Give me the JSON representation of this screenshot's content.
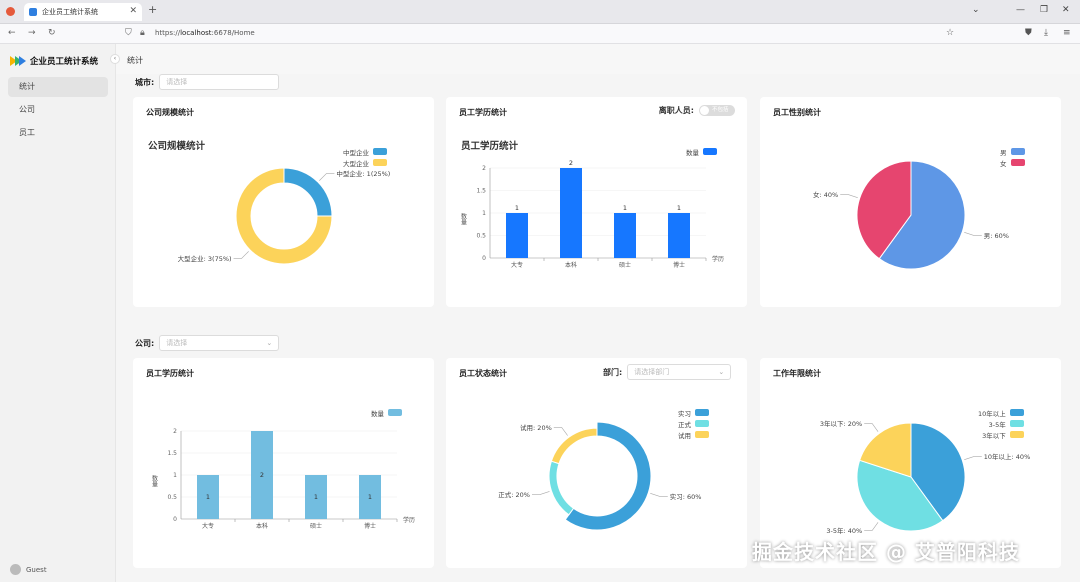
{
  "browser": {
    "tab_title": "企业员工统计系统",
    "url_prefix": "https://",
    "url_host": "localhost",
    "url_rest": ":6678/Home"
  },
  "sidebar": {
    "app_title": "企业员工统计系统",
    "items": [
      {
        "label": "统计",
        "active": true
      },
      {
        "label": "公司",
        "active": false
      },
      {
        "label": "员工",
        "active": false
      }
    ],
    "user": "Guest"
  },
  "breadcrumb": "统计",
  "filters": {
    "city_label": "城市:",
    "city_placeholder": "请选择",
    "company_label": "公司:",
    "company_placeholder": "请选择"
  },
  "cards": {
    "company_scale": {
      "title": "公司规模统计",
      "chart_title": "公司规模统计"
    },
    "edu1": {
      "title": "员工学历统计",
      "chart_title": "员工学历统计",
      "toggle_label": "离职人员:",
      "toggle_text": "不包括"
    },
    "gender": {
      "title": "员工性别统计"
    },
    "edu2": {
      "title": "员工学历统计"
    },
    "status": {
      "title": "员工状态统计",
      "dept_label": "部门:",
      "dept_placeholder": "请选择部门"
    },
    "tenure": {
      "title": "工作年限统计"
    }
  },
  "colors": {
    "blue": "#3ba0d9",
    "yellow": "#fcd35a",
    "bar_blue": "#1677ff",
    "male": "#5e97e6",
    "female": "#e6456f",
    "light_bar": "#72bde0",
    "cyan": "#6fdfe3"
  },
  "chart_data": [
    {
      "type": "pie",
      "subtype": "donut",
      "legend": [
        "中型企业",
        "大型企业"
      ],
      "slices": [
        {
          "name": "中型企业",
          "value": 1,
          "label": "中型企业: 1(25%)"
        },
        {
          "name": "大型企业",
          "value": 3,
          "label": "大型企业: 3(75%)"
        }
      ]
    },
    {
      "type": "bar",
      "categories": [
        "大专",
        "本科",
        "硕士",
        "博士"
      ],
      "series": [
        {
          "name": "数量",
          "values": [
            1,
            2,
            1,
            1
          ]
        }
      ],
      "ylabel": "数量",
      "xlabel": "学历",
      "yticks": [
        "0",
        "0.5",
        "1",
        "1.5",
        "2"
      ],
      "ylim": [
        0,
        2
      ]
    },
    {
      "type": "pie",
      "legend": [
        "男",
        "女"
      ],
      "slices": [
        {
          "name": "男",
          "value": 60,
          "label": "男: 60%"
        },
        {
          "name": "女",
          "value": 40,
          "label": "女: 40%"
        }
      ]
    },
    {
      "type": "bar",
      "categories": [
        "大专",
        "本科",
        "硕士",
        "博士"
      ],
      "series": [
        {
          "name": "数量",
          "values": [
            1,
            2,
            1,
            1
          ]
        }
      ],
      "ylabel": "数量",
      "xlabel": "学历",
      "yticks": [
        "0",
        "0.5",
        "1",
        "1.5",
        "2"
      ],
      "ylim": [
        0,
        2
      ]
    },
    {
      "type": "pie",
      "subtype": "donut",
      "legend": [
        "实习",
        "正式",
        "试用"
      ],
      "slices": [
        {
          "name": "实习",
          "value": 60,
          "label": "实习: 60%"
        },
        {
          "name": "正式",
          "value": 20,
          "label": "正式: 20%"
        },
        {
          "name": "试用",
          "value": 20,
          "label": "试用: 20%"
        }
      ]
    },
    {
      "type": "pie",
      "legend": [
        "10年以上",
        "3-5年",
        "3年以下"
      ],
      "slices": [
        {
          "name": "10年以上",
          "value": 40,
          "label": "10年以上: 40%"
        },
        {
          "name": "3-5年",
          "value": 40,
          "label": "3-5年: 40%"
        },
        {
          "name": "3年以下",
          "value": 20,
          "label": "3年以下: 20%"
        }
      ]
    }
  ],
  "watermark": "掘金技术社区 @ 艾普阳科技"
}
